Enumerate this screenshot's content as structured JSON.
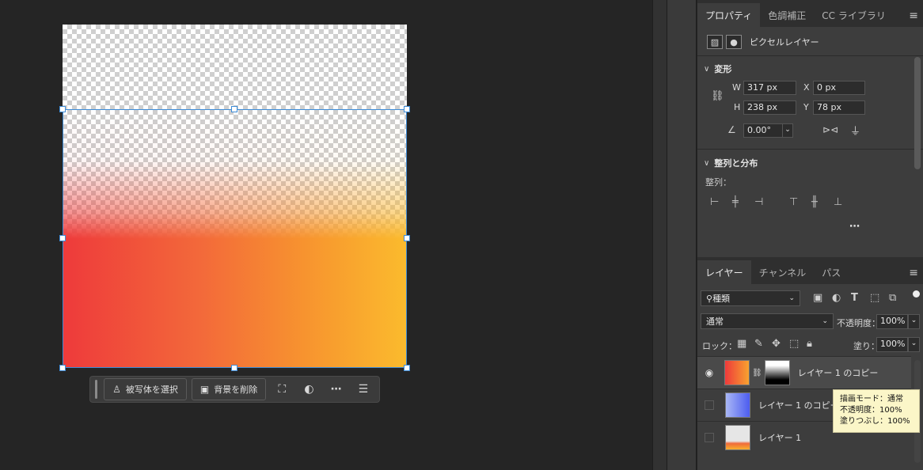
{
  "taskbar": {
    "select_subject": "被写体を選択",
    "remove_bg": "背景を削除"
  },
  "properties_panel": {
    "tabs": [
      "プロパティ",
      "色調補正",
      "CC ライブラリ"
    ],
    "layer_type": "ピクセルレイヤー",
    "transform": {
      "title": "変形",
      "w_label": "W",
      "w_value": "317 px",
      "x_label": "X",
      "x_value": "0 px",
      "h_label": "H",
      "h_value": "238 px",
      "y_label": "Y",
      "y_value": "78 px",
      "angle": "0.00°"
    },
    "align": {
      "title": "整列と分布",
      "label": "整列："
    }
  },
  "layers_panel": {
    "tabs": [
      "レイヤー",
      "チャンネル",
      "パス"
    ],
    "filter_kind": "種類",
    "blend_mode": "通常",
    "opacity_label": "不透明度：",
    "opacity_value": "100%",
    "lock_label": "ロック：",
    "fill_label": "塗り：",
    "fill_value": "100%",
    "layers": [
      {
        "name": "レイヤー 1 のコピー",
        "visible": true,
        "selected": true,
        "has_mask": true
      },
      {
        "name": "レイヤー 1 のコピー",
        "visible": false,
        "selected": false,
        "has_mask": false
      },
      {
        "name": "レイヤー 1",
        "visible": false,
        "selected": false,
        "has_mask": false
      }
    ],
    "tooltip": {
      "blend": "描画モード：通常",
      "opacity": "不透明度：100%",
      "fill": "塗りつぶし：100%"
    }
  },
  "colors": {
    "selection": "#3d8bd6",
    "gradient_start": "#ee3a3b",
    "gradient_end": "#fbbb2d"
  }
}
